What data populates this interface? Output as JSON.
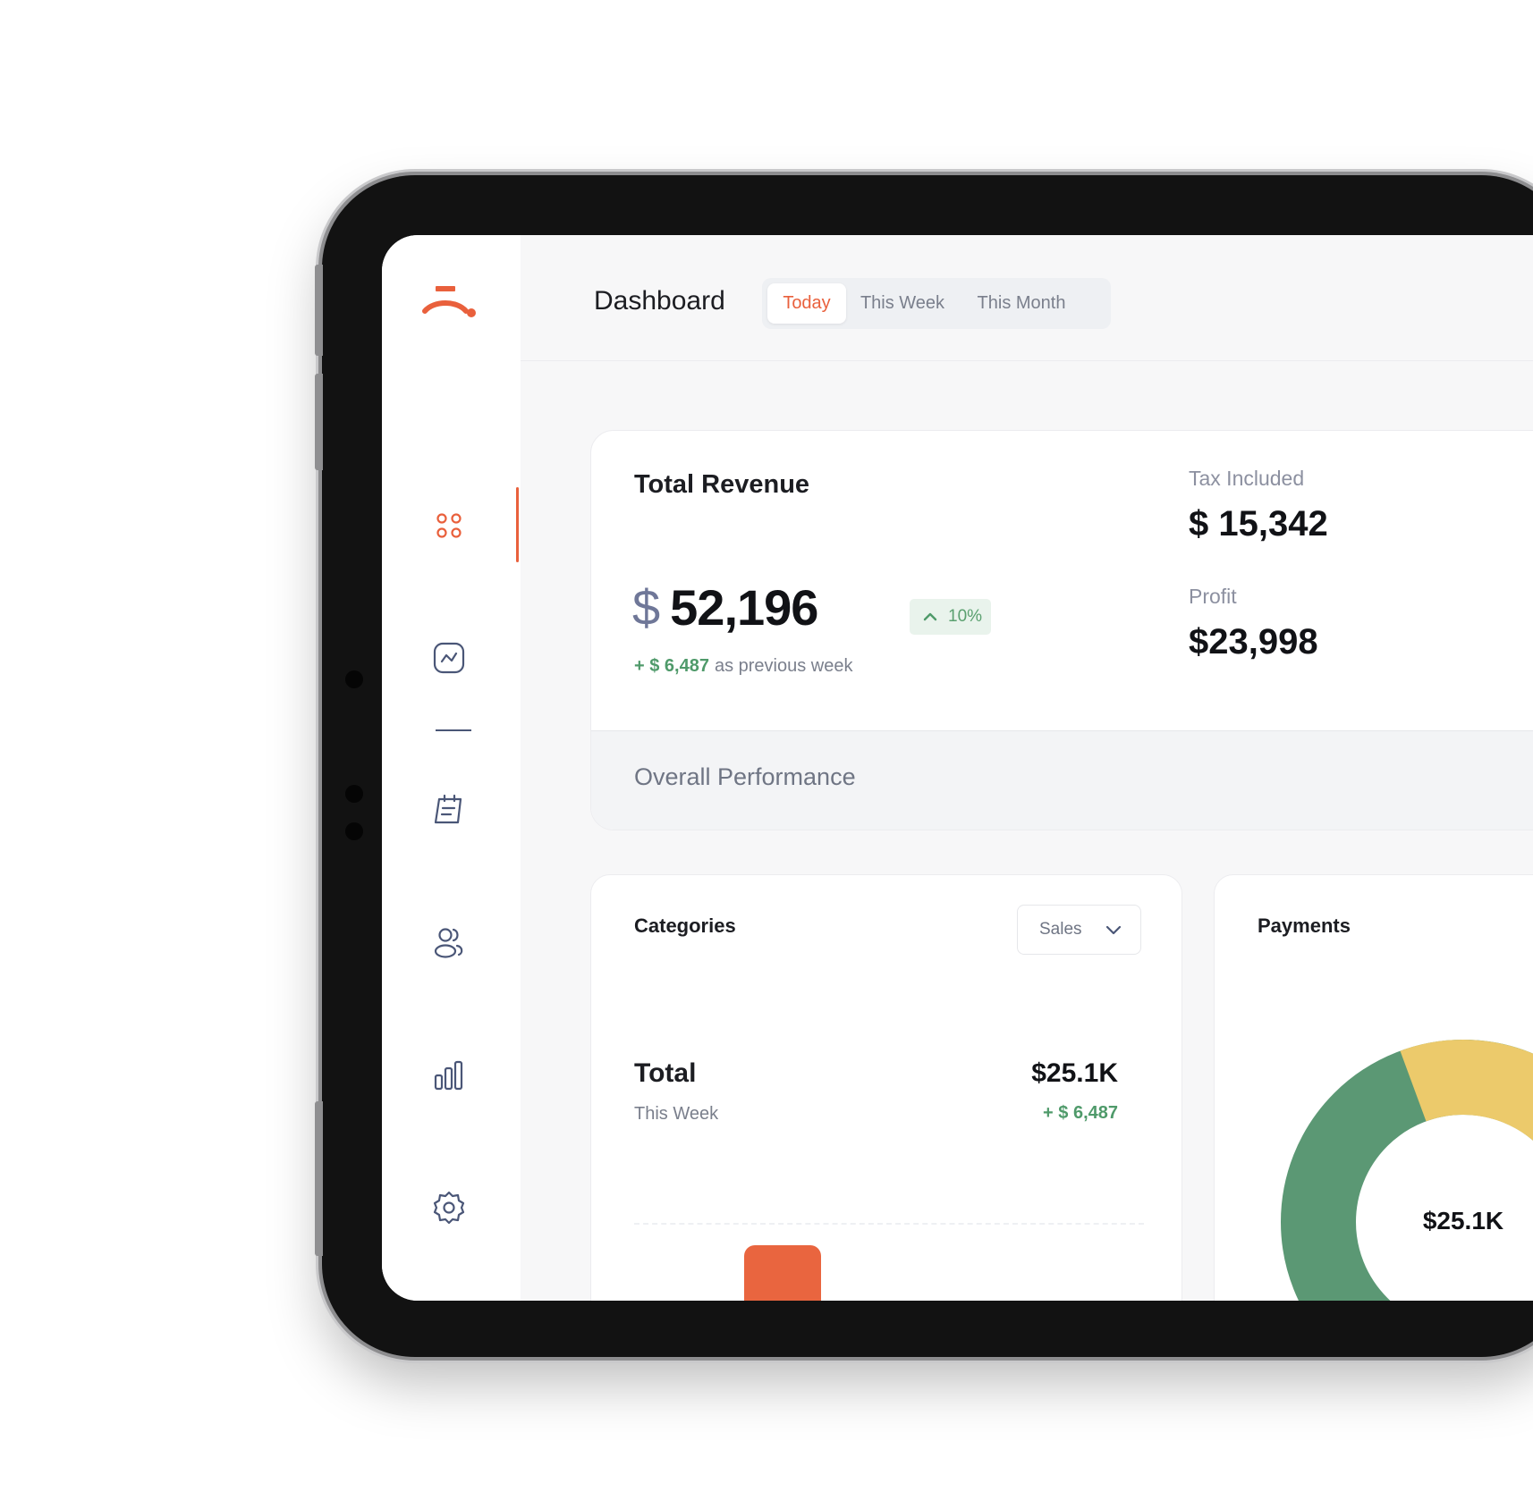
{
  "app": {
    "page_title": "Dashboard",
    "accent_color": "#e9603c"
  },
  "period_tabs": [
    {
      "label": "Today",
      "active": true
    },
    {
      "label": "This Week",
      "active": false
    },
    {
      "label": "This Month",
      "active": false
    }
  ],
  "sidebar": {
    "logo": "brand-logo",
    "items": [
      {
        "icon": "grid-dots-icon",
        "active": true
      },
      {
        "icon": "analytics-icon",
        "active": false
      },
      {
        "icon": "orders-icon",
        "active": false
      },
      {
        "icon": "users-icon",
        "active": false
      },
      {
        "icon": "bar-chart-icon",
        "active": false
      },
      {
        "icon": "settings-icon",
        "active": false
      }
    ]
  },
  "revenue": {
    "title": "Total Revenue",
    "currency": "$",
    "amount": "52,196",
    "change_pct": "10%",
    "change_direction": "up",
    "delta": "+ $ 6,487",
    "delta_suffix": "as previous week",
    "tax_label": "Tax Included",
    "tax_value": "$ 15,342",
    "profit_label": "Profit",
    "profit_value": "$23,998",
    "performance_label": "Overall Performance"
  },
  "categories": {
    "title": "Categories",
    "filter_value": "Sales",
    "total_label": "Total",
    "total_period": "This Week",
    "total_value": "$25.1K",
    "total_delta": "+ $ 6,487"
  },
  "payments": {
    "title": "Payments",
    "center_value": "$25.1K",
    "segment_colors": {
      "green": "#5b9874",
      "yellow": "#ecca6b"
    }
  }
}
